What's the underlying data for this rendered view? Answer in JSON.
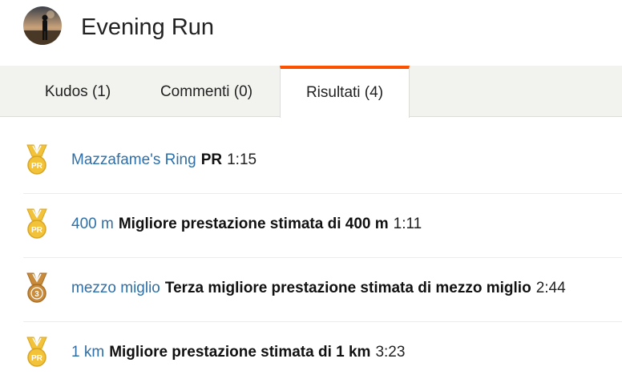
{
  "activity": {
    "title": "Evening Run"
  },
  "tabs": [
    {
      "label": "Kudos (1)",
      "active": false
    },
    {
      "label": "Commenti (0)",
      "active": false
    },
    {
      "label": "Risultati (4)",
      "active": true
    }
  ],
  "results": [
    {
      "segment": "Mazzafame's Ring",
      "achievement": "PR",
      "time": "1:15",
      "icon": "gold-pr-medal-icon",
      "medal_text": "PR"
    },
    {
      "segment": "400 m",
      "achievement": "Migliore prestazione stimata di 400 m",
      "time": "1:11",
      "icon": "gold-pr-medal-icon",
      "medal_text": "PR"
    },
    {
      "segment": "mezzo miglio",
      "achievement": "Terza migliore prestazione stimata di mezzo miglio",
      "time": "2:44",
      "icon": "bronze-third-medal-icon",
      "medal_text": "3"
    },
    {
      "segment": "1 km",
      "achievement": "Migliore prestazione stimata di 1 km",
      "time": "3:23",
      "icon": "gold-pr-medal-icon",
      "medal_text": "PR"
    }
  ],
  "colors": {
    "accent": "#fc5200",
    "link": "#2f6fa7",
    "gold_medal": "#f2c23a",
    "bronze_medal": "#c98b3c"
  }
}
